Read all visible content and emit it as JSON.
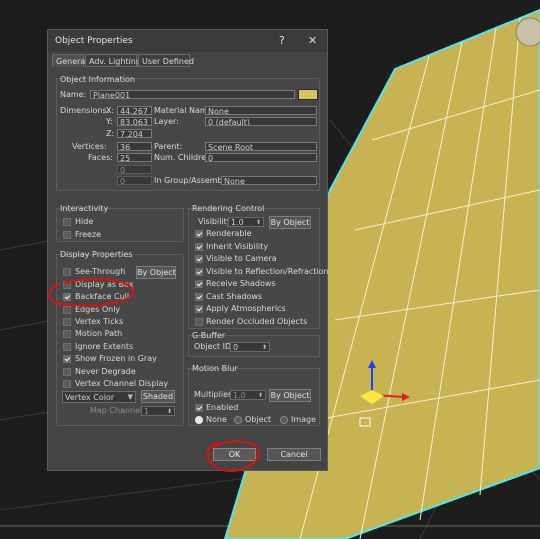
{
  "dialog": {
    "title": "Object Properties",
    "help": "?",
    "close": "✕",
    "tabs": [
      "General",
      "Adv. Lighting",
      "User Defined"
    ],
    "object_info": {
      "group_title": "Object Information",
      "name_label": "Name:",
      "name_value": "Plane001",
      "name_color": "#d9c462",
      "dimensions_label": "Dimensions:",
      "x_label": "X:",
      "x_value": "44.267",
      "y_label": "Y:",
      "y_value": "83.063",
      "z_label": "Z:",
      "z_value": "7.204",
      "vertices_label": "Vertices:",
      "vertices_value": "36",
      "faces_label": "Faces:",
      "faces_value": "25",
      "blank1": "0",
      "blank2": "0",
      "material_label": "Material Name:",
      "material_value": "None",
      "layer_label": "Layer:",
      "layer_value": "0 (default)",
      "parent_label": "Parent:",
      "parent_value": "Scene Root",
      "children_label": "Num. Children:",
      "children_value": "0",
      "group_label": "In Group/Assembly:",
      "group_value": "None"
    },
    "interactivity": {
      "title": "Interactivity",
      "hide": "Hide",
      "freeze": "Freeze"
    },
    "display": {
      "title": "Display Properties",
      "see_through": "See-Through",
      "by_object": "By Object",
      "display_as_box": "Display as Box",
      "backface_cull": "Backface Cull",
      "edges_only": "Edges Only",
      "vertex_ticks": "Vertex Ticks",
      "motion_path": "Motion Path",
      "ignore_extents": "Ignore Extents",
      "show_frozen_gray": "Show Frozen in Gray",
      "never_degrade": "Never Degrade",
      "vertex_channel": "Vertex Channel Display",
      "vertex_color": "Vertex Color",
      "shaded": "Shaded",
      "map_channel_label": "Map Channel:",
      "map_channel_value": "1"
    },
    "rendering": {
      "title": "Rendering Control",
      "visibility_label": "Visibility:",
      "visibility_value": "1.0",
      "by_object": "By Object",
      "renderable": "Renderable",
      "inherit_visibility": "Inherit Visibility",
      "visible_camera": "Visible to Camera",
      "visible_reflection": "Visible to Reflection/Refraction",
      "receive_shadows": "Receive Shadows",
      "cast_shadows": "Cast Shadows",
      "apply_atmospherics": "Apply Atmospherics",
      "render_occluded": "Render Occluded Objects"
    },
    "gbuffer": {
      "title": "G-Buffer",
      "object_id_label": "Object ID:",
      "object_id_value": "0"
    },
    "motion_blur": {
      "title": "Motion Blur",
      "multiplier_label": "Multiplier:",
      "multiplier_value": "1.0",
      "by_object": "By Object",
      "enabled": "Enabled",
      "none": "None",
      "object": "Object",
      "image": "Image"
    },
    "ok": "OK",
    "cancel": "Cancel"
  },
  "colors": {
    "viewport_bg": "#1d1d1d",
    "plane_fill": "#c7b351",
    "plane_outline": "#4fe6ee",
    "annotation": "#e01010"
  }
}
